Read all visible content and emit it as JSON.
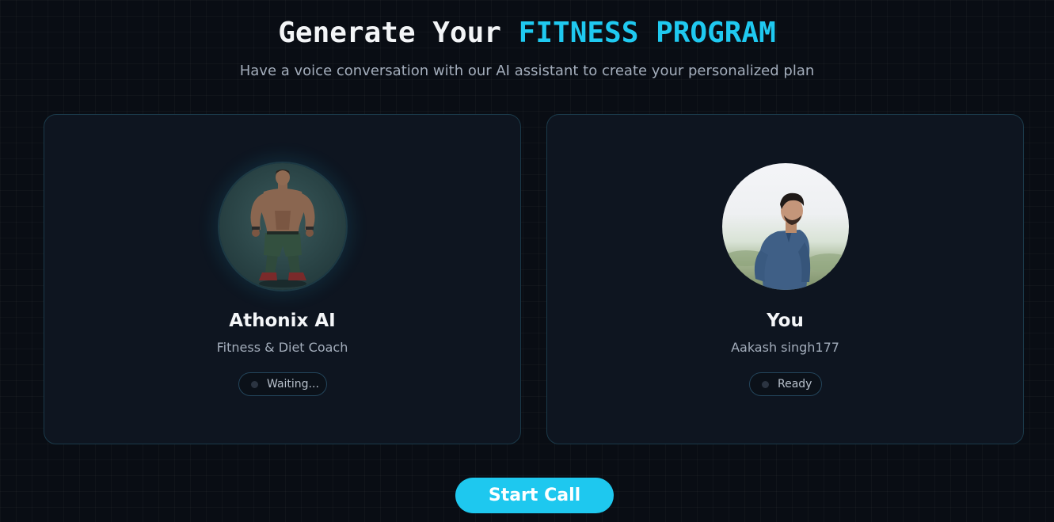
{
  "header": {
    "title_plain": "Generate Your",
    "title_accent": "FITNESS PROGRAM",
    "subtitle": "Have a voice conversation with our AI assistant to create your personalized plan"
  },
  "assistant_card": {
    "avatar_icon": "bodybuilder-avatar",
    "name": "Athonix AI",
    "role": "Fitness & Diet Coach",
    "status": "Waiting..."
  },
  "user_card": {
    "avatar_icon": "user-photo-avatar",
    "name": "You",
    "username": "Aakash singh177",
    "status": "Ready"
  },
  "actions": {
    "start_call_label": "Start Call"
  },
  "colors": {
    "accent": "#1fc9f0",
    "background": "#090d14",
    "card": "#0e1520",
    "card_border": "#1b3a4a"
  }
}
